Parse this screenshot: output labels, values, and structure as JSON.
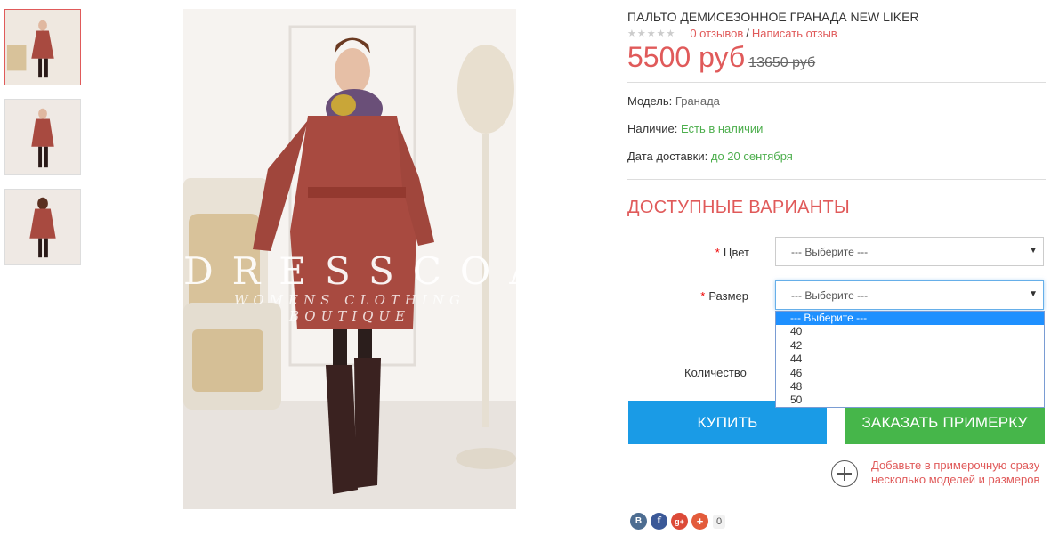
{
  "product": {
    "title": "ПАЛЬТО ДЕМИСЕЗОННОЕ ГРАНАДА NEW LIKER",
    "stars": "★★★★★",
    "reviews_link": "0 отзывов",
    "separator": "/",
    "write_review_link": "Написать отзыв",
    "price_new": "5500 руб",
    "price_old": "13650 руб"
  },
  "details": {
    "model_label": "Модель:",
    "model_value": "Гранада",
    "availability_label": "Наличие:",
    "availability_value": "Есть в наличии",
    "delivery_label": "Дата доставки:",
    "delivery_value": "до 20 сентября"
  },
  "variants": {
    "heading": "ДОСТУПНЫЕ ВАРИАНТЫ",
    "required_mark": "*",
    "color_label": "Цвет",
    "color_value": "--- Выберите ---",
    "size_label": "Размер",
    "size_value": "--- Выберите ---",
    "size_options": [
      "--- Выберите ---",
      "40",
      "42",
      "44",
      "46",
      "48",
      "50"
    ],
    "quantity_label": "Количество"
  },
  "actions": {
    "buy_label": "КУПИТЬ",
    "fitting_label": "ЗАКАЗАТЬ ПРИМЕРКУ",
    "fitting_note": "Добавьте в примерочную сразу несколько моделей и размеров"
  },
  "gallery": {
    "thumb_count": 3,
    "watermark": "DRESSCOAT",
    "watermark_sub": "WOMENS CLOTHING BOUTIQUE"
  },
  "social": {
    "vk": "B",
    "facebook": "f",
    "google_plus": "g+",
    "more": "+",
    "count": "0"
  },
  "colors": {
    "accent_red": "#e05a5a",
    "buy_blue": "#1a9be6",
    "fitting_green": "#46b64a",
    "coat": "#a84a40"
  }
}
